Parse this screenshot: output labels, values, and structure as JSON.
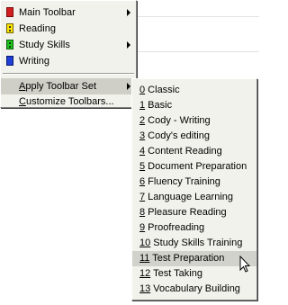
{
  "main_menu": {
    "items": [
      {
        "label": "Main Toolbar",
        "icon": "red-toolbar-icon",
        "submenu": true
      },
      {
        "label": "Reading",
        "icon": "yellow-toolbar-icon",
        "submenu": false
      },
      {
        "label": "Study Skills",
        "icon": "green-toolbar-icon",
        "submenu": true
      },
      {
        "label": "Writing",
        "icon": "blue-toolbar-icon",
        "submenu": false
      }
    ],
    "apply_toolbar_set": {
      "prefix": "A",
      "rest": "pply Toolbar Set"
    },
    "customize_toolbars": {
      "prefix": "C",
      "rest": "ustomize Toolbars..."
    }
  },
  "submenu": {
    "items": [
      {
        "num": "0",
        "rest": " Classic"
      },
      {
        "num": "1",
        "rest": " Basic"
      },
      {
        "num": "2",
        "rest": " Cody - Writing"
      },
      {
        "num": "3",
        "rest": " Cody's editing"
      },
      {
        "num": "4",
        "rest": " Content Reading"
      },
      {
        "num": "5",
        "rest": " Document Preparation"
      },
      {
        "num": "6",
        "rest": " Fluency Training"
      },
      {
        "num": "7",
        "rest": " Language Learning"
      },
      {
        "num": "8",
        "rest": " Pleasure Reading"
      },
      {
        "num": "9",
        "rest": " Proofreading"
      },
      {
        "num": "10",
        "rest": " Study Skills Training"
      },
      {
        "num": "11",
        "rest": " Test Preparation"
      },
      {
        "num": "12",
        "rest": " Test Taking"
      },
      {
        "num": "13",
        "rest": " Vocabulary Building"
      }
    ],
    "hovered_index": 11
  },
  "colors": {
    "menu_bg": "#f2f2ec",
    "active_bg": "#cfcfc8",
    "hover_bg": "#d2d2cc",
    "icon_red": "#d21e1e",
    "icon_yellow": "#ffe600",
    "icon_green": "#1fc41f",
    "icon_blue": "#1f3fd8"
  }
}
